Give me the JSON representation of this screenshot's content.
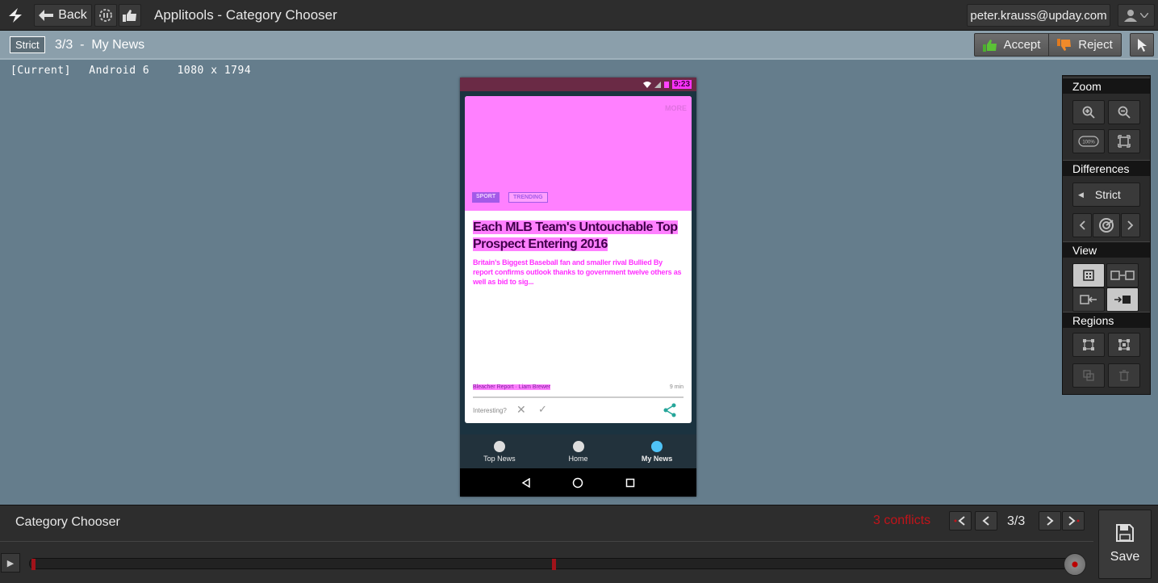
{
  "header": {
    "back_label": "Back",
    "app_title": "Applitools - Category Chooser",
    "user_email": "peter.krauss@upday.com"
  },
  "subbar": {
    "match_level": "Strict",
    "step_title": "3/3  -  My News",
    "accept_label": "Accept",
    "reject_label": "Reject"
  },
  "info": {
    "state": "[Current]",
    "platform": "Android 6",
    "resolution": "1080 x 1794"
  },
  "phone": {
    "time": "9:23",
    "more": "MORE",
    "tags": [
      "SPORT",
      "TRENDING"
    ],
    "headline": "Each MLB Team's Untouchable Top Prospect Entering 2016",
    "snippet": "Britain's Biggest Baseball fan and smaller rival Bullied By report confirms outlook thanks to government twelve others as well as bid to sig...",
    "source": "Bleacher Report · Liam Brewer",
    "read_time": "9 min",
    "interesting_label": "Interesting?",
    "nav": [
      "Top News",
      "Home",
      "My News"
    ]
  },
  "tools": {
    "zoom_title": "Zoom",
    "differences_title": "Differences",
    "strict_label": "Strict",
    "view_title": "View",
    "regions_title": "Regions",
    "zoom_100_label": "100%"
  },
  "footer": {
    "test_name": "Category Chooser",
    "conflicts": "3 conflicts",
    "counter": "3/3",
    "save_label": "Save"
  },
  "colors": {
    "diff_highlight": "#ff80ff",
    "conflict_red": "#c0141a",
    "background": "#657d8c"
  }
}
